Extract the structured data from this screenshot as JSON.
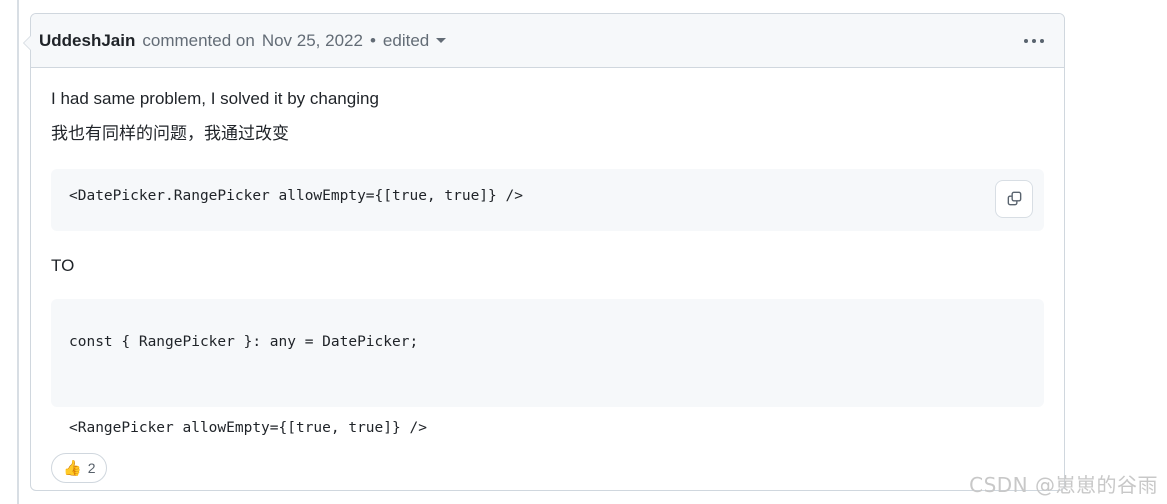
{
  "comment": {
    "author": "UddeshJain",
    "action": "commented on",
    "date": "Nov 25, 2022",
    "separator": "•",
    "edited_label": "edited",
    "caret_icon": "chevron-down-icon",
    "menu_icon": "kebab-horizontal-icon"
  },
  "body": {
    "paragraph_en": "I had same problem, I solved it by changing",
    "paragraph_zh": "我也有同样的问题，我通过改变",
    "transition_label": "TO",
    "code_block_1": "<DatePicker.RangePicker allowEmpty={[true, true]} />",
    "code_block_2": "const { RangePicker }: any = DatePicker;\n\n<RangePicker allowEmpty={[true, true]} />",
    "copy_icon": "copy-icon"
  },
  "reactions": {
    "thumbs_up_emoji": "👍",
    "thumbs_up_count": "2"
  },
  "watermark": {
    "text": "CSDN @崽崽的谷雨"
  },
  "colors": {
    "header_bg": "#f6f8fa",
    "border": "#d0d7de",
    "text": "#1f2328",
    "muted_text": "#636c76",
    "code_bg": "#f6f8fa",
    "rail": "#d8dee4",
    "watermark": "#c8c8c8"
  }
}
